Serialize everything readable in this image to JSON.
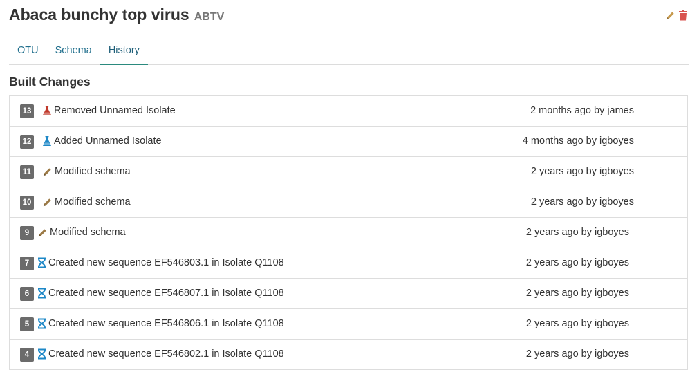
{
  "header": {
    "title": "Abaca bunchy top virus",
    "abbreviation": "ABTV"
  },
  "tabs": [
    {
      "label": "OTU",
      "active": false
    },
    {
      "label": "Schema",
      "active": false
    },
    {
      "label": "History",
      "active": true
    }
  ],
  "section": {
    "title": "Built Changes"
  },
  "changes": [
    {
      "index": "13",
      "icon": "flask-icon",
      "icon_color": "#c0392b",
      "description": "Removed Unnamed Isolate",
      "when": "2 months ago by james"
    },
    {
      "index": "12",
      "icon": "flask-icon",
      "icon_color": "#1e88c7",
      "description": "Added Unnamed Isolate",
      "when": "4 months ago by igboyes"
    },
    {
      "index": "11",
      "icon": "pencil-icon",
      "icon_color": "#9c7a46",
      "description": "Modified schema",
      "when": "2 years ago by igboyes"
    },
    {
      "index": "10",
      "icon": "pencil-icon",
      "icon_color": "#9c7a46",
      "description": "Modified schema",
      "when": "2 years ago by igboyes"
    },
    {
      "index": "9",
      "icon": "pencil-icon",
      "icon_color": "#9c7a46",
      "description": "Modified schema",
      "when": "2 years ago by igboyes"
    },
    {
      "index": "7",
      "icon": "dna-icon",
      "icon_color": "#1e88c7",
      "description": "Created new sequence EF546803.1 in Isolate Q1108",
      "when": "2 years ago by igboyes"
    },
    {
      "index": "6",
      "icon": "dna-icon",
      "icon_color": "#1e88c7",
      "description": "Created new sequence EF546807.1 in Isolate Q1108",
      "when": "2 years ago by igboyes"
    },
    {
      "index": "5",
      "icon": "dna-icon",
      "icon_color": "#1e88c7",
      "description": "Created new sequence EF546806.1 in Isolate Q1108",
      "when": "2 years ago by igboyes"
    },
    {
      "index": "4",
      "icon": "dna-icon",
      "icon_color": "#1e88c7",
      "description": "Created new sequence EF546802.1 in Isolate Q1108",
      "when": "2 years ago by igboyes"
    }
  ],
  "colors": {
    "edit_icon": "#c79a4e",
    "delete_icon": "#d9534f",
    "tab_link": "#1f6e8c",
    "tab_active_border": "#2b8a7e",
    "badge_bg": "#6b6b6b"
  }
}
